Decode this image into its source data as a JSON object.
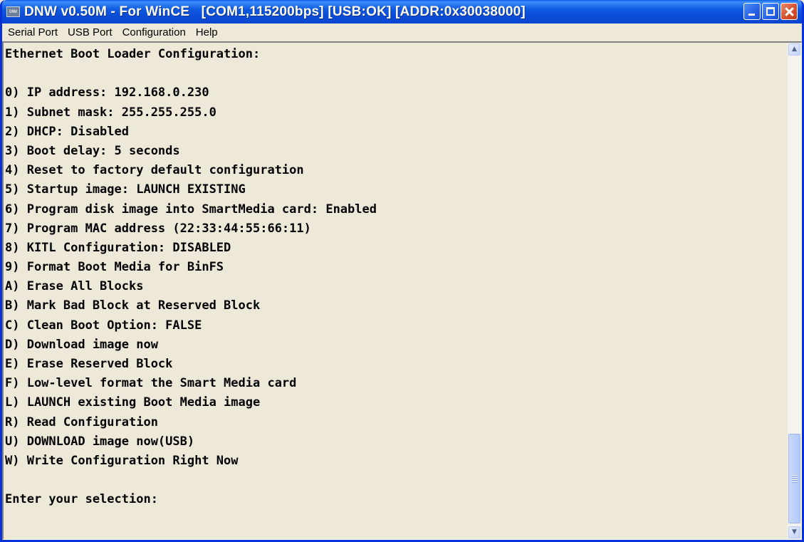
{
  "window": {
    "title": "DNW v0.50M - For WinCE   [COM1,115200bps] [USB:OK] [ADDR:0x30038000]",
    "icon_text": "DNW"
  },
  "menubar": {
    "items": [
      {
        "label": "Serial Port"
      },
      {
        "label": "USB Port"
      },
      {
        "label": "Configuration"
      },
      {
        "label": "Help"
      }
    ]
  },
  "terminal": {
    "lines": [
      "Ethernet Boot Loader Configuration:",
      "",
      "0) IP address: 192.168.0.230",
      "1) Subnet mask: 255.255.255.0",
      "2) DHCP: Disabled",
      "3) Boot delay: 5 seconds",
      "4) Reset to factory default configuration",
      "5) Startup image: LAUNCH EXISTING",
      "6) Program disk image into SmartMedia card: Enabled",
      "7) Program MAC address (22:33:44:55:66:11)",
      "8) KITL Configuration: DISABLED",
      "9) Format Boot Media for BinFS",
      "A) Erase All Blocks",
      "B) Mark Bad Block at Reserved Block",
      "C) Clean Boot Option: FALSE",
      "D) Download image now",
      "E) Erase Reserved Block",
      "F) Low-level format the Smart Media card",
      "L) LAUNCH existing Boot Media image",
      "R) Read Configuration",
      "U) DOWNLOAD image now(USB)",
      "W) Write Configuration Right Now",
      "",
      "Enter your selection:"
    ]
  },
  "icons": {
    "app": "dnw-app-icon",
    "minimize": "minimize-icon",
    "maximize": "maximize-icon",
    "close": "close-icon",
    "scroll_up": "chevron-up-icon",
    "scroll_down": "chevron-down-icon"
  },
  "colors": {
    "titlebar": "#0a4bd6",
    "close_button": "#d6502e",
    "terminal_bg": "#ece9d8",
    "terminal_text": "#000000"
  },
  "scroll": {
    "position_fraction": 1.0
  }
}
